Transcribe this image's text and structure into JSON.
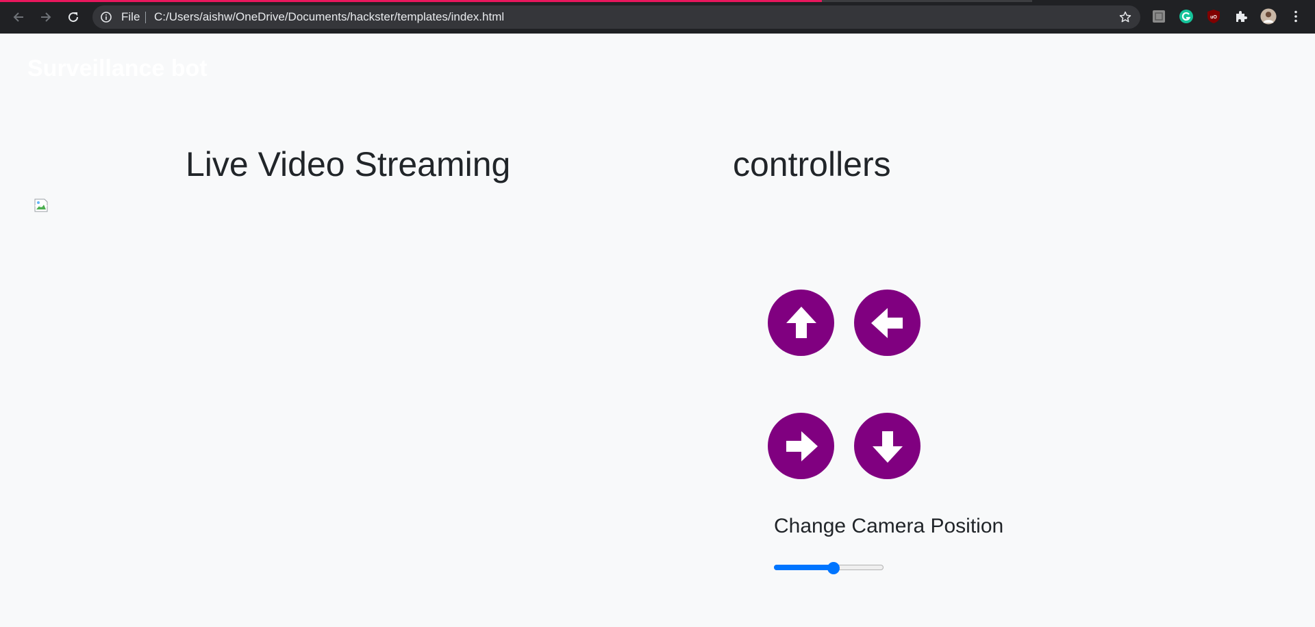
{
  "browser": {
    "omnibox": {
      "scheme_label": "File",
      "url": "C:/Users/aishw/OneDrive/Documents/hackster/templates/index.html"
    },
    "load_progress": 0.625,
    "extensions": [
      "unknown-extension-icon",
      "grammarly-icon",
      "ublock-icon",
      "puzzle-piece-icon",
      "profile-avatar"
    ]
  },
  "page": {
    "brand": "Surveillance bot",
    "video_heading": "Live Video Streaming",
    "controllers_heading": "controllers",
    "controls": {
      "up_icon": "arrow-up-icon",
      "left_icon": "arrow-left-icon",
      "right_icon": "arrow-right-icon",
      "down_icon": "arrow-down-icon",
      "button_color": "#800080"
    },
    "camera": {
      "label": "Change Camera Position",
      "slider_value_fraction": 0.55
    }
  },
  "colors": {
    "chrome_bg": "#202124",
    "omnibox_bg": "#35363a",
    "loading_bar": "#e8175d",
    "page_bg": "#f8f9fa",
    "slider_accent": "#0075ff"
  }
}
